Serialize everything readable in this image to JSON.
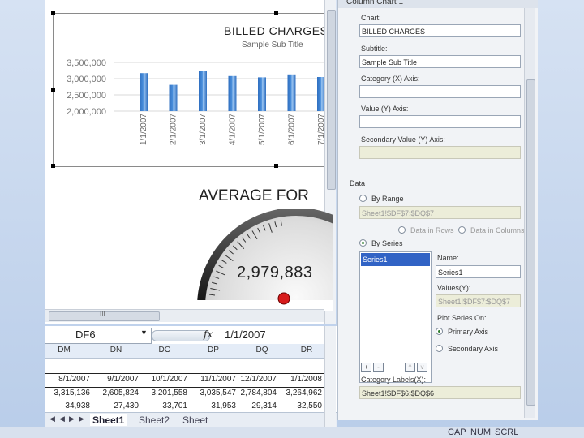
{
  "chart": {
    "title": "BILLED CHARGES",
    "subtitle": "Sample Sub Title"
  },
  "chart_data": {
    "type": "bar",
    "title": "BILLED CHARGES",
    "subtitle": "Sample Sub Title",
    "categories": [
      "1/1/2007",
      "2/1/2007",
      "3/1/2007",
      "4/1/2007",
      "5/1/2007",
      "6/1/2007",
      "7/1/2007"
    ],
    "values": [
      3170000,
      2810000,
      3240000,
      3080000,
      3040000,
      3130000,
      3050000
    ],
    "yticks": [
      "3,500,000",
      "3,000,000",
      "2,500,000",
      "2,000,000"
    ],
    "ylim": [
      2000000,
      3500000
    ],
    "grid": true,
    "bar_color": "#4a8fdc"
  },
  "gauge": {
    "title": "AVERAGE FOR",
    "value": "2,979,883"
  },
  "scrollbar": {
    "grip": "III"
  },
  "formula": {
    "namebox": "DF6",
    "fx": "fx",
    "value": "1/1/2007"
  },
  "columns": [
    "DM",
    "DN",
    "DO",
    "DP",
    "DQ",
    "DR"
  ],
  "rows": [
    [
      "8/1/2007",
      "9/1/2007",
      "10/1/2007",
      "11/1/2007",
      "12/1/2007",
      "1/1/2008"
    ],
    [
      "3,315,136",
      "2,605,824",
      "3,201,558",
      "3,035,547",
      "2,784,804",
      "3,264,962"
    ],
    [
      "34,938",
      "27,430",
      "33,701",
      "31,953",
      "29,314",
      "32,550"
    ]
  ],
  "tabs": [
    "Sheet1",
    "Sheet2",
    "Sheet"
  ],
  "tab_nav": [
    "◀",
    "◀",
    "▶",
    "▶"
  ],
  "pane": {
    "header": "Column Chart 1",
    "chart_label": "Chart:",
    "chart_value": "BILLED CHARGES",
    "subtitle_label": "Subtitle:",
    "subtitle_value": "Sample Sub Title",
    "category_label": "Category (X) Axis:",
    "value_label": "Value (Y) Axis:",
    "secondary_label": "Secondary Value (Y) Axis:",
    "data_label": "Data",
    "by_range": "By Range",
    "range_value": "Sheet1!$DF$7:$DQ$7",
    "data_rows": "Data in Rows",
    "data_columns": "Data in Columns",
    "by_series": "By Series",
    "series_item": "Series1",
    "name_label": "Name:",
    "name_value": "Series1",
    "values_label": "Values(Y):",
    "values_value": "Sheet1!$DF$7:$DQ$7",
    "plot_label": "Plot Series On:",
    "primary_axis": "Primary Axis",
    "secondary_axis": "Secondary Axis",
    "add_btn": "+",
    "remove_btn": "-",
    "up_btn": "^",
    "down_btn": "v",
    "catlabels_label": "Category Labels(X):",
    "catlabels_value": "Sheet1!$DF$6:$DQ$6"
  },
  "status": {
    "cap": "CAP",
    "num": "NUM",
    "scrl": "SCRL"
  }
}
